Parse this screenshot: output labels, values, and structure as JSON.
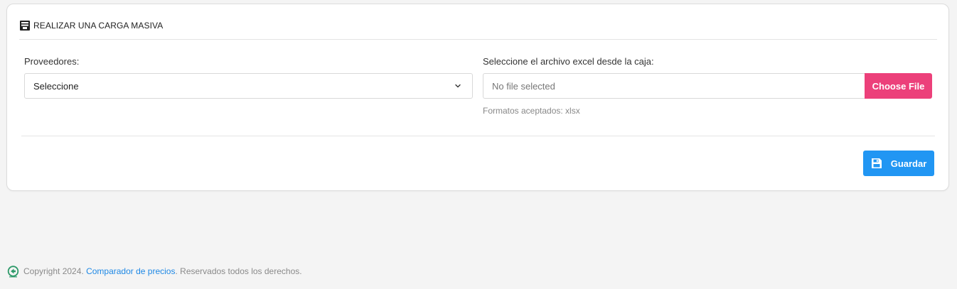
{
  "card": {
    "title": "REALIZAR UNA CARGA MASIVA",
    "icon": "form-list-icon"
  },
  "providers": {
    "label": "Proveedores:",
    "selected": "Seleccione"
  },
  "file": {
    "label": "Seleccione el archivo excel desde la caja:",
    "placeholder": "No file selected",
    "button_label": "Choose File",
    "help": "Formatos aceptados: xlsx"
  },
  "actions": {
    "save_label": "Guardar",
    "save_icon": "floppy-disk-icon"
  },
  "footer": {
    "prefix": "Copyright 2024.",
    "link_text": "Comparador de precios",
    "suffix": ". Reservados todos los derechos."
  },
  "colors": {
    "choose_button": "#ec407a",
    "save_button": "#2196f3",
    "link": "#1e88e5",
    "footer_logo": "#2e9a6a"
  }
}
